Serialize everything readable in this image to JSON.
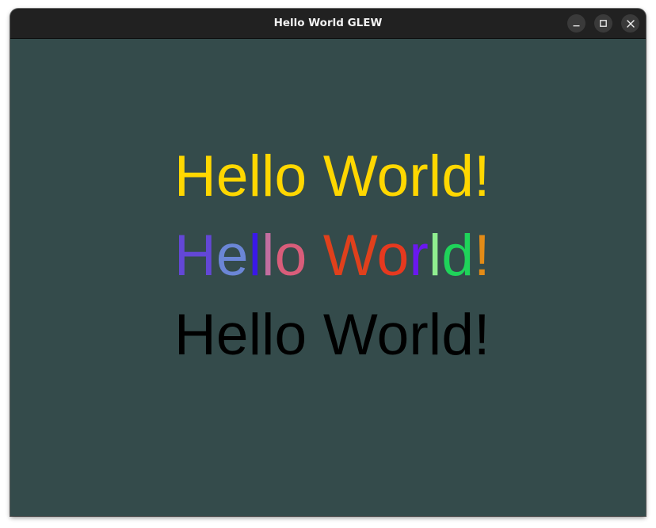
{
  "window": {
    "title": "Hello World GLEW",
    "controls": {
      "minimize_icon": "minimize-icon",
      "maximize_icon": "maximize-icon",
      "close_icon": "close-icon"
    }
  },
  "canvas": {
    "background": "#344b4b",
    "lines": [
      {
        "text": "Hello World!",
        "color": "#ffd700"
      },
      {
        "text": "Hello World!",
        "letters": [
          {
            "char": "H",
            "color": "#6347d6"
          },
          {
            "char": "e",
            "color": "#6b86d6"
          },
          {
            "char": "l",
            "color": "#3a18e8"
          },
          {
            "char": "l",
            "color": "#c36ea0"
          },
          {
            "char": "o",
            "color": "#d95d7a"
          },
          {
            "char": " ",
            "color": "#000000"
          },
          {
            "char": "W",
            "color": "#e0401c"
          },
          {
            "char": "o",
            "color": "#e6391f"
          },
          {
            "char": "r",
            "color": "#6a18f0"
          },
          {
            "char": "l",
            "color": "#90ee90"
          },
          {
            "char": "d",
            "color": "#1fd45a"
          },
          {
            "char": "!",
            "color": "#e38b16"
          }
        ]
      },
      {
        "text": "Hello World!",
        "color": "#000000"
      }
    ]
  }
}
